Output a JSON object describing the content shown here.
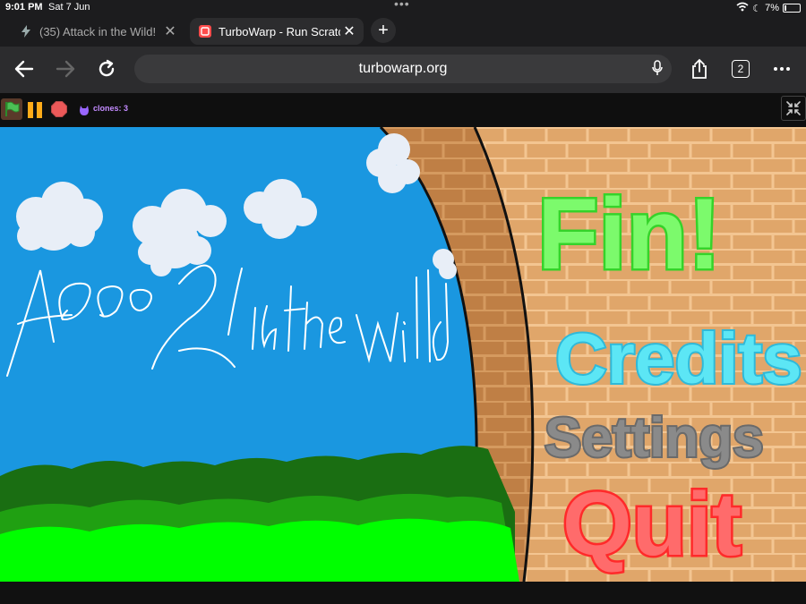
{
  "status_bar": {
    "time": "9:01 PM",
    "date": "Sat 7 Jun",
    "battery": "7%"
  },
  "tabs": [
    {
      "title": "(35) Attack in the Wild!",
      "icon": "lightning-icon",
      "active": false
    },
    {
      "title": "TurboWarp - Run Scratch",
      "icon": "turbowarp-icon",
      "active": true
    }
  ],
  "toolbar": {
    "url": "turbowarp.org",
    "tab_count": "2"
  },
  "controls": {
    "clones": "clones: 3"
  },
  "game": {
    "title": "Attack 2 in the Wild",
    "menu": {
      "play": "Fin!",
      "credits": "Credits",
      "settings": "Settings",
      "quit": "Quit"
    }
  },
  "colors": {
    "sky": "#1a97e0",
    "brick": "#e0a66a",
    "play": "#7cfa6c",
    "credits": "#5ce6f5",
    "settings": "#8a8a8a",
    "quit": "#ff6b6b",
    "bush_light": "#00ff00",
    "bush_dark": "#1a6e12"
  }
}
